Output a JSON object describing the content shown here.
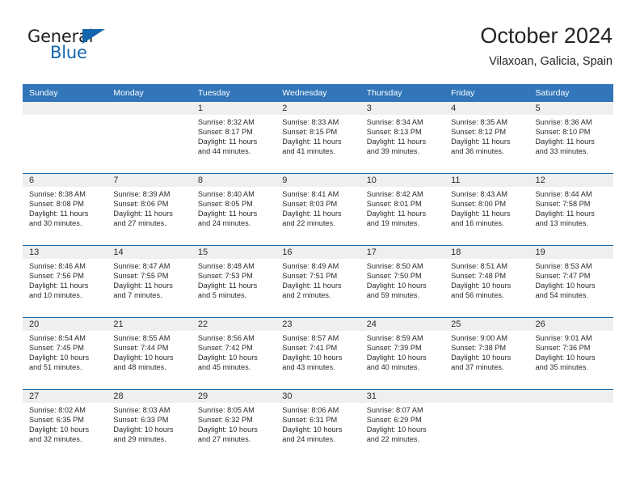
{
  "brand": {
    "name_part1": "General",
    "name_part2": "Blue",
    "flag_icon": "blue-triangle-flag-icon"
  },
  "header": {
    "title": "October 2024",
    "subtitle": "Vilaxoan, Galicia, Spain"
  },
  "colors": {
    "header_blue": "#3275b8",
    "row_divider_blue": "#1a6aab",
    "daynum_band": "#efefef",
    "brand_blue": "#1566ad",
    "text": "#2b2b2b"
  },
  "calendar": {
    "weekday_headers": [
      "Sunday",
      "Monday",
      "Tuesday",
      "Wednesday",
      "Thursday",
      "Friday",
      "Saturday"
    ],
    "labels": {
      "sunrise": "Sunrise:",
      "sunset": "Sunset:",
      "daylight": "Daylight:"
    },
    "weeks": [
      [
        {
          "day": "",
          "empty": true
        },
        {
          "day": "",
          "empty": true
        },
        {
          "day": "1",
          "sunrise": "Sunrise: 8:32 AM",
          "sunset": "Sunset: 8:17 PM",
          "daylight": "Daylight: 11 hours and 44 minutes."
        },
        {
          "day": "2",
          "sunrise": "Sunrise: 8:33 AM",
          "sunset": "Sunset: 8:15 PM",
          "daylight": "Daylight: 11 hours and 41 minutes."
        },
        {
          "day": "3",
          "sunrise": "Sunrise: 8:34 AM",
          "sunset": "Sunset: 8:13 PM",
          "daylight": "Daylight: 11 hours and 39 minutes."
        },
        {
          "day": "4",
          "sunrise": "Sunrise: 8:35 AM",
          "sunset": "Sunset: 8:12 PM",
          "daylight": "Daylight: 11 hours and 36 minutes."
        },
        {
          "day": "5",
          "sunrise": "Sunrise: 8:36 AM",
          "sunset": "Sunset: 8:10 PM",
          "daylight": "Daylight: 11 hours and 33 minutes."
        }
      ],
      [
        {
          "day": "6",
          "sunrise": "Sunrise: 8:38 AM",
          "sunset": "Sunset: 8:08 PM",
          "daylight": "Daylight: 11 hours and 30 minutes."
        },
        {
          "day": "7",
          "sunrise": "Sunrise: 8:39 AM",
          "sunset": "Sunset: 8:06 PM",
          "daylight": "Daylight: 11 hours and 27 minutes."
        },
        {
          "day": "8",
          "sunrise": "Sunrise: 8:40 AM",
          "sunset": "Sunset: 8:05 PM",
          "daylight": "Daylight: 11 hours and 24 minutes."
        },
        {
          "day": "9",
          "sunrise": "Sunrise: 8:41 AM",
          "sunset": "Sunset: 8:03 PM",
          "daylight": "Daylight: 11 hours and 22 minutes."
        },
        {
          "day": "10",
          "sunrise": "Sunrise: 8:42 AM",
          "sunset": "Sunset: 8:01 PM",
          "daylight": "Daylight: 11 hours and 19 minutes."
        },
        {
          "day": "11",
          "sunrise": "Sunrise: 8:43 AM",
          "sunset": "Sunset: 8:00 PM",
          "daylight": "Daylight: 11 hours and 16 minutes."
        },
        {
          "day": "12",
          "sunrise": "Sunrise: 8:44 AM",
          "sunset": "Sunset: 7:58 PM",
          "daylight": "Daylight: 11 hours and 13 minutes."
        }
      ],
      [
        {
          "day": "13",
          "sunrise": "Sunrise: 8:46 AM",
          "sunset": "Sunset: 7:56 PM",
          "daylight": "Daylight: 11 hours and 10 minutes."
        },
        {
          "day": "14",
          "sunrise": "Sunrise: 8:47 AM",
          "sunset": "Sunset: 7:55 PM",
          "daylight": "Daylight: 11 hours and 7 minutes."
        },
        {
          "day": "15",
          "sunrise": "Sunrise: 8:48 AM",
          "sunset": "Sunset: 7:53 PM",
          "daylight": "Daylight: 11 hours and 5 minutes."
        },
        {
          "day": "16",
          "sunrise": "Sunrise: 8:49 AM",
          "sunset": "Sunset: 7:51 PM",
          "daylight": "Daylight: 11 hours and 2 minutes."
        },
        {
          "day": "17",
          "sunrise": "Sunrise: 8:50 AM",
          "sunset": "Sunset: 7:50 PM",
          "daylight": "Daylight: 10 hours and 59 minutes."
        },
        {
          "day": "18",
          "sunrise": "Sunrise: 8:51 AM",
          "sunset": "Sunset: 7:48 PM",
          "daylight": "Daylight: 10 hours and 56 minutes."
        },
        {
          "day": "19",
          "sunrise": "Sunrise: 8:53 AM",
          "sunset": "Sunset: 7:47 PM",
          "daylight": "Daylight: 10 hours and 54 minutes."
        }
      ],
      [
        {
          "day": "20",
          "sunrise": "Sunrise: 8:54 AM",
          "sunset": "Sunset: 7:45 PM",
          "daylight": "Daylight: 10 hours and 51 minutes."
        },
        {
          "day": "21",
          "sunrise": "Sunrise: 8:55 AM",
          "sunset": "Sunset: 7:44 PM",
          "daylight": "Daylight: 10 hours and 48 minutes."
        },
        {
          "day": "22",
          "sunrise": "Sunrise: 8:56 AM",
          "sunset": "Sunset: 7:42 PM",
          "daylight": "Daylight: 10 hours and 45 minutes."
        },
        {
          "day": "23",
          "sunrise": "Sunrise: 8:57 AM",
          "sunset": "Sunset: 7:41 PM",
          "daylight": "Daylight: 10 hours and 43 minutes."
        },
        {
          "day": "24",
          "sunrise": "Sunrise: 8:59 AM",
          "sunset": "Sunset: 7:39 PM",
          "daylight": "Daylight: 10 hours and 40 minutes."
        },
        {
          "day": "25",
          "sunrise": "Sunrise: 9:00 AM",
          "sunset": "Sunset: 7:38 PM",
          "daylight": "Daylight: 10 hours and 37 minutes."
        },
        {
          "day": "26",
          "sunrise": "Sunrise: 9:01 AM",
          "sunset": "Sunset: 7:36 PM",
          "daylight": "Daylight: 10 hours and 35 minutes."
        }
      ],
      [
        {
          "day": "27",
          "sunrise": "Sunrise: 8:02 AM",
          "sunset": "Sunset: 6:35 PM",
          "daylight": "Daylight: 10 hours and 32 minutes."
        },
        {
          "day": "28",
          "sunrise": "Sunrise: 8:03 AM",
          "sunset": "Sunset: 6:33 PM",
          "daylight": "Daylight: 10 hours and 29 minutes."
        },
        {
          "day": "29",
          "sunrise": "Sunrise: 8:05 AM",
          "sunset": "Sunset: 6:32 PM",
          "daylight": "Daylight: 10 hours and 27 minutes."
        },
        {
          "day": "30",
          "sunrise": "Sunrise: 8:06 AM",
          "sunset": "Sunset: 6:31 PM",
          "daylight": "Daylight: 10 hours and 24 minutes."
        },
        {
          "day": "31",
          "sunrise": "Sunrise: 8:07 AM",
          "sunset": "Sunset: 6:29 PM",
          "daylight": "Daylight: 10 hours and 22 minutes."
        },
        {
          "day": "",
          "empty": true
        },
        {
          "day": "",
          "empty": true
        }
      ]
    ]
  }
}
